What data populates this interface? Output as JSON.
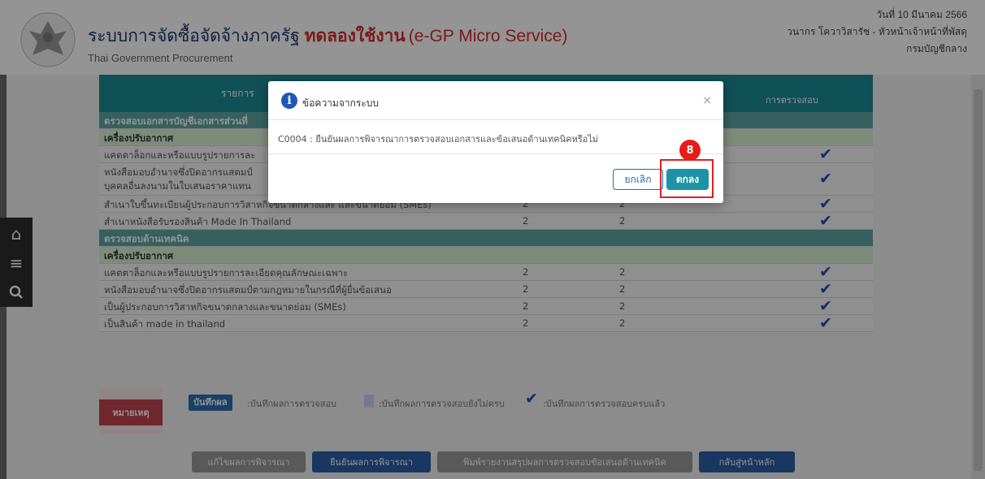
{
  "header": {
    "title": "ระบบการจัดซื้อจัดจ้างภาครัฐ",
    "trial": "ทดลองใช้งาน",
    "micro": "(e-GP Micro Service)",
    "subtitle": "Thai Government Procurement",
    "date": "วันที่ 10 มีนาคม 2566",
    "user": "วนากร โควาวิสารัช - หัวหน้าเจ้าหน้าที่พัสดุ",
    "department": "กรมบัญชีกลาง"
  },
  "table": {
    "header": {
      "item": "รายการ",
      "inspection": "การตรวจสอบ"
    },
    "rows": [
      {
        "type": "sec",
        "label": "ตรวจสอบเอกสารบัญชีเอกสารส่วนที่"
      },
      {
        "type": "sub",
        "label": "เครื่องปรับอากาศ"
      },
      {
        "type": "item",
        "label": "แคตตาล็อกและหรือแบบรูปรายการละ",
        "n1": "",
        "n2": "",
        "check": "✔"
      },
      {
        "type": "item",
        "label": "หนังสือมอบอำนาจซึ่งปิดอากรแสตมป์",
        "label2": "บุคคลอื่นลงนามในใบเสนอราคาแทน",
        "n1": "",
        "n2": "",
        "check": "✔",
        "tall": true
      },
      {
        "type": "item",
        "label": "สำเนาใบขึ้นทะเบียนผู้ประกอบการวิสาหกิจขนาดกลางและ และขนาดย่อม (SMEs)",
        "n1": "2",
        "n2": "2",
        "check": "✔"
      },
      {
        "type": "item",
        "label": "สำเนาหนังสือรับรองสินค้า Made In Thailand",
        "n1": "2",
        "n2": "2",
        "check": "✔"
      },
      {
        "type": "sec",
        "label": "ตรวจสอบด้านเทคนิค"
      },
      {
        "type": "sub",
        "label": "เครื่องปรับอากาศ"
      },
      {
        "type": "item",
        "label": "แคตตาล็อกและหรือแบบรูปรายการละเอียดคุณลักษณะเฉพาะ",
        "n1": "2",
        "n2": "2",
        "check": "✔"
      },
      {
        "type": "item",
        "label": "หนังสือมอบอำนาจซึ่งปิดอากรแสตมป์ตามกฎหมายในกรณีที่ผู้ยื่นข้อเสนอ",
        "n1": "2",
        "n2": "2",
        "check": "✔"
      },
      {
        "type": "item",
        "label": "เป็นผู้ประกอบการวิสาหกิจขนาดกลางและขนาดย่อม (SMEs)",
        "n1": "2",
        "n2": "2",
        "check": "✔"
      },
      {
        "type": "item",
        "label": "เป็นสินค้า made in thailand",
        "n1": "2",
        "n2": "2",
        "check": "✔"
      }
    ]
  },
  "legend": {
    "note": "หมายเหตุ",
    "save_chip": "บันทึกผล",
    "save_text": ":บันทึกผลการตรวจสอบ",
    "partial_text": ":บันทึกผลการตรวจสอบยังไม่ครบ",
    "complete_text": ":บันทึกผลการตรวจสอบครบแล้ว"
  },
  "buttons": {
    "edit": "แก้ไขผลการพิจารณา",
    "confirm": "ยืนยันผลการพิจารณา",
    "print": "พิมพ์รายงานสรุปผลการตรวจสอบข้อเสนอด้านเทคนิค",
    "back": "กลับสู่หน้าหลัก"
  },
  "modal": {
    "title": "ข้อความจากระบบ",
    "close": "×",
    "message": "C0004 : ยืนยันผลการพิจารณาการตรวจสอบเอกสารและข้อเสนอด้านเทคนิคหรือไม่",
    "cancel": "ยกเลิก",
    "ok": "ตกลง"
  },
  "step_badge": "8",
  "colors": {
    "header_teal": "#1d8a96",
    "section": "#5ea6a6",
    "subsection": "#d7f0d5",
    "ok_button": "#1d93a6",
    "highlight": "#e0201e"
  }
}
